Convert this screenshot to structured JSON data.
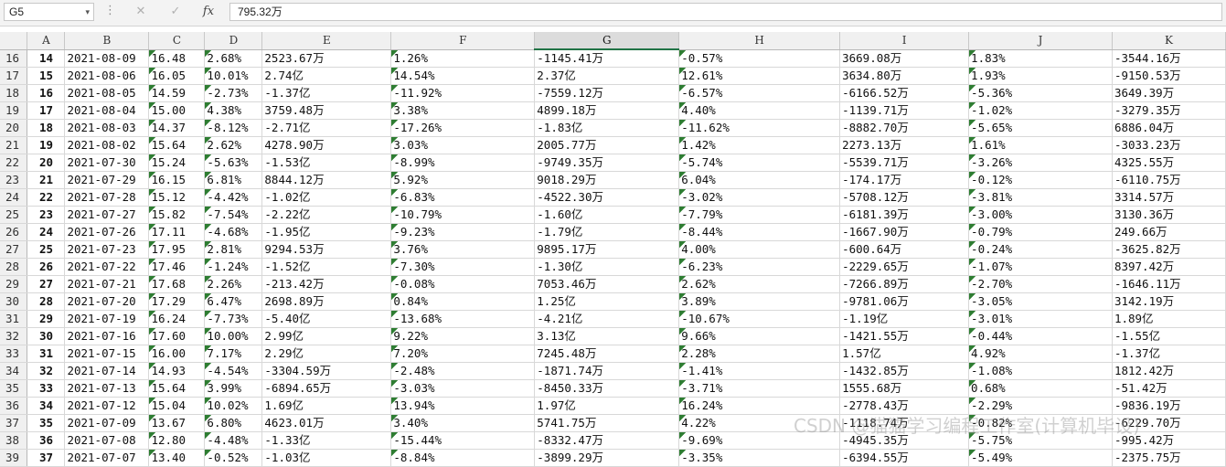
{
  "formula_bar": {
    "name_box": "G5",
    "name_box_arrow": "▾",
    "separator": "⋮",
    "cancel_icon": "✕",
    "enter_icon": "✓",
    "fx_label": "fx",
    "formula": "795.32万"
  },
  "columns": [
    "A",
    "B",
    "C",
    "D",
    "E",
    "F",
    "G",
    "H",
    "I",
    "J",
    "K"
  ],
  "selected_column": "G",
  "rows": [
    {
      "r": "16",
      "A": "14",
      "B": "2021-08-09",
      "C": "16.48",
      "D": "2.68%",
      "E": "2523.67万",
      "F": "1.26%",
      "G": "-1145.41万",
      "H": "-0.57%",
      "I": "3669.08万",
      "J": "1.83%",
      "K": "-3544.16万"
    },
    {
      "r": "17",
      "A": "15",
      "B": "2021-08-06",
      "C": "16.05",
      "D": "10.01%",
      "E": "2.74亿",
      "F": "14.54%",
      "G": "2.37亿",
      "H": "12.61%",
      "I": "3634.80万",
      "J": "1.93%",
      "K": "-9150.53万"
    },
    {
      "r": "18",
      "A": "16",
      "B": "2021-08-05",
      "C": "14.59",
      "D": "-2.73%",
      "E": "-1.37亿",
      "F": "-11.92%",
      "G": "-7559.12万",
      "H": "-6.57%",
      "I": "-6166.52万",
      "J": "-5.36%",
      "K": "3649.39万"
    },
    {
      "r": "19",
      "A": "17",
      "B": "2021-08-04",
      "C": "15.00",
      "D": "4.38%",
      "E": "3759.48万",
      "F": "3.38%",
      "G": "4899.18万",
      "H": "4.40%",
      "I": "-1139.71万",
      "J": "-1.02%",
      "K": "-3279.35万"
    },
    {
      "r": "20",
      "A": "18",
      "B": "2021-08-03",
      "C": "14.37",
      "D": "-8.12%",
      "E": "-2.71亿",
      "F": "-17.26%",
      "G": "-1.83亿",
      "H": "-11.62%",
      "I": "-8882.70万",
      "J": "-5.65%",
      "K": "6886.04万"
    },
    {
      "r": "21",
      "A": "19",
      "B": "2021-08-02",
      "C": "15.64",
      "D": "2.62%",
      "E": "4278.90万",
      "F": "3.03%",
      "G": "2005.77万",
      "H": "1.42%",
      "I": "2273.13万",
      "J": "1.61%",
      "K": "-3033.23万"
    },
    {
      "r": "22",
      "A": "20",
      "B": "2021-07-30",
      "C": "15.24",
      "D": "-5.63%",
      "E": "-1.53亿",
      "F": "-8.99%",
      "G": "-9749.35万",
      "H": "-5.74%",
      "I": "-5539.71万",
      "J": "-3.26%",
      "K": "4325.55万"
    },
    {
      "r": "23",
      "A": "21",
      "B": "2021-07-29",
      "C": "16.15",
      "D": "6.81%",
      "E": "8844.12万",
      "F": "5.92%",
      "G": "9018.29万",
      "H": "6.04%",
      "I": "-174.17万",
      "J": "-0.12%",
      "K": "-6110.75万"
    },
    {
      "r": "24",
      "A": "22",
      "B": "2021-07-28",
      "C": "15.12",
      "D": "-4.42%",
      "E": "-1.02亿",
      "F": "-6.83%",
      "G": "-4522.30万",
      "H": "-3.02%",
      "I": "-5708.12万",
      "J": "-3.81%",
      "K": "3314.57万"
    },
    {
      "r": "25",
      "A": "23",
      "B": "2021-07-27",
      "C": "15.82",
      "D": "-7.54%",
      "E": "-2.22亿",
      "F": "-10.79%",
      "G": "-1.60亿",
      "H": "-7.79%",
      "I": "-6181.39万",
      "J": "-3.00%",
      "K": "3130.36万"
    },
    {
      "r": "26",
      "A": "24",
      "B": "2021-07-26",
      "C": "17.11",
      "D": "-4.68%",
      "E": "-1.95亿",
      "F": "-9.23%",
      "G": "-1.79亿",
      "H": "-8.44%",
      "I": "-1667.90万",
      "J": "-0.79%",
      "K": "249.66万"
    },
    {
      "r": "27",
      "A": "25",
      "B": "2021-07-23",
      "C": "17.95",
      "D": "2.81%",
      "E": "9294.53万",
      "F": "3.76%",
      "G": "9895.17万",
      "H": "4.00%",
      "I": "-600.64万",
      "J": "-0.24%",
      "K": "-3625.82万"
    },
    {
      "r": "28",
      "A": "26",
      "B": "2021-07-22",
      "C": "17.46",
      "D": "-1.24%",
      "E": "-1.52亿",
      "F": "-7.30%",
      "G": "-1.30亿",
      "H": "-6.23%",
      "I": "-2229.65万",
      "J": "-1.07%",
      "K": "8397.42万"
    },
    {
      "r": "29",
      "A": "27",
      "B": "2021-07-21",
      "C": "17.68",
      "D": "2.26%",
      "E": "-213.42万",
      "F": "-0.08%",
      "G": "7053.46万",
      "H": "2.62%",
      "I": "-7266.89万",
      "J": "-2.70%",
      "K": "-1646.11万"
    },
    {
      "r": "30",
      "A": "28",
      "B": "2021-07-20",
      "C": "17.29",
      "D": "6.47%",
      "E": "2698.89万",
      "F": "0.84%",
      "G": "1.25亿",
      "H": "3.89%",
      "I": "-9781.06万",
      "J": "-3.05%",
      "K": "3142.19万"
    },
    {
      "r": "31",
      "A": "29",
      "B": "2021-07-19",
      "C": "16.24",
      "D": "-7.73%",
      "E": "-5.40亿",
      "F": "-13.68%",
      "G": "-4.21亿",
      "H": "-10.67%",
      "I": "-1.19亿",
      "J": "-3.01%",
      "K": "1.89亿"
    },
    {
      "r": "32",
      "A": "30",
      "B": "2021-07-16",
      "C": "17.60",
      "D": "10.00%",
      "E": "2.99亿",
      "F": "9.22%",
      "G": "3.13亿",
      "H": "9.66%",
      "I": "-1421.55万",
      "J": "-0.44%",
      "K": "-1.55亿"
    },
    {
      "r": "33",
      "A": "31",
      "B": "2021-07-15",
      "C": "16.00",
      "D": "7.17%",
      "E": "2.29亿",
      "F": "7.20%",
      "G": "7245.48万",
      "H": "2.28%",
      "I": "1.57亿",
      "J": "4.92%",
      "K": "-1.37亿"
    },
    {
      "r": "34",
      "A": "32",
      "B": "2021-07-14",
      "C": "14.93",
      "D": "-4.54%",
      "E": "-3304.59万",
      "F": "-2.48%",
      "G": "-1871.74万",
      "H": "-1.41%",
      "I": "-1432.85万",
      "J": "-1.08%",
      "K": "1812.42万"
    },
    {
      "r": "35",
      "A": "33",
      "B": "2021-07-13",
      "C": "15.64",
      "D": "3.99%",
      "E": "-6894.65万",
      "F": "-3.03%",
      "G": "-8450.33万",
      "H": "-3.71%",
      "I": "1555.68万",
      "J": "0.68%",
      "K": "-51.42万"
    },
    {
      "r": "36",
      "A": "34",
      "B": "2021-07-12",
      "C": "15.04",
      "D": "10.02%",
      "E": "1.69亿",
      "F": "13.94%",
      "G": "1.97亿",
      "H": "16.24%",
      "I": "-2778.43万",
      "J": "-2.29%",
      "K": "-9836.19万"
    },
    {
      "r": "37",
      "A": "35",
      "B": "2021-07-09",
      "C": "13.67",
      "D": "6.80%",
      "E": "4623.01万",
      "F": "3.40%",
      "G": "5741.75万",
      "H": "4.22%",
      "I": "-1118.74万",
      "J": "-0.82%",
      "K": "-6229.70万"
    },
    {
      "r": "38",
      "A": "36",
      "B": "2021-07-08",
      "C": "12.80",
      "D": "-4.48%",
      "E": "-1.33亿",
      "F": "-15.44%",
      "G": "-8332.47万",
      "H": "-9.69%",
      "I": "-4945.35万",
      "J": "-5.75%",
      "K": "-995.42万"
    },
    {
      "r": "39",
      "A": "37",
      "B": "2021-07-07",
      "C": "13.40",
      "D": "-0.52%",
      "E": "-1.03亿",
      "F": "-8.84%",
      "G": "-3899.29万",
      "H": "-3.35%",
      "I": "-6394.55万",
      "J": "-5.49%",
      "K": "-2375.75万"
    }
  ],
  "watermark": "CSDN @猫猫学习编程工作室(计算机毕设)"
}
